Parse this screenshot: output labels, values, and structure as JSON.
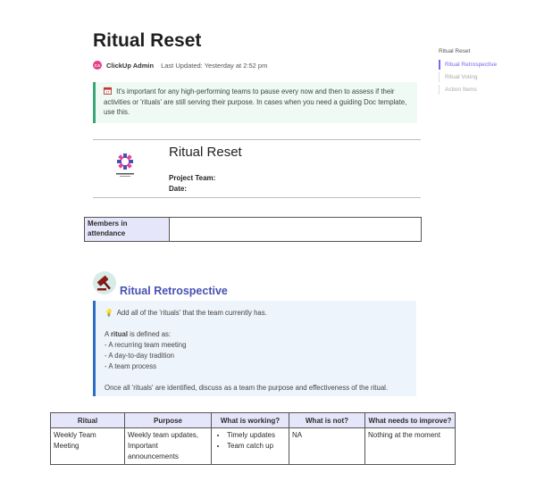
{
  "doc": {
    "title": "Ritual Reset",
    "author_initials": "CA",
    "author": "ClickUp Admin",
    "last_updated": "Last Updated: Yesterday at 2:52 pm"
  },
  "intro_callout": {
    "icon": "calendar-icon",
    "text": "It's important for any high-performing teams to pause every now and then to assess if their activities or 'rituals' are still serving their purpose. In cases when you need a guiding Doc template, use this."
  },
  "header_block": {
    "subtitle": "Ritual Reset",
    "project_team_label": "Project Team:",
    "date_label": "Date:"
  },
  "members": {
    "label": "Members in attendance",
    "value": ""
  },
  "retro": {
    "title": "Ritual Retrospective",
    "callout": {
      "line1": "Add all of the 'rituals' that the team currently has.",
      "def_prefix": "A ",
      "def_bold": "ritual",
      "def_suffix": " is defined as:",
      "items": [
        "- A recurring team meeting",
        "- A day-to-day tradition",
        "- A team process"
      ],
      "closing": "Once all 'rituals' are identified, discuss as a team the purpose and effectiveness of the ritual."
    }
  },
  "ritual_table": {
    "headers": [
      "Ritual",
      "Purpose",
      "What is working?",
      "What is not?",
      "What needs to improve?"
    ],
    "rows": [
      {
        "ritual": "Weekly Team Meeting",
        "purpose": "Weekly team updates, Important announcements",
        "working": [
          "Timely updates",
          "Team catch up"
        ],
        "not": "NA",
        "improve": "Nothing at the moment"
      }
    ]
  },
  "toc": {
    "title": "Ritual Reset",
    "items": [
      "Ritual Retrospective",
      "Ritual Voting",
      "Action Items"
    ],
    "active_index": 0
  },
  "colors": {
    "accent": "#7b68ee",
    "heading_blue": "#4651b3",
    "callout_green_border": "#3aa577",
    "callout_blue_border": "#2d6dc7",
    "table_header_bg": "#e6e6fa"
  }
}
